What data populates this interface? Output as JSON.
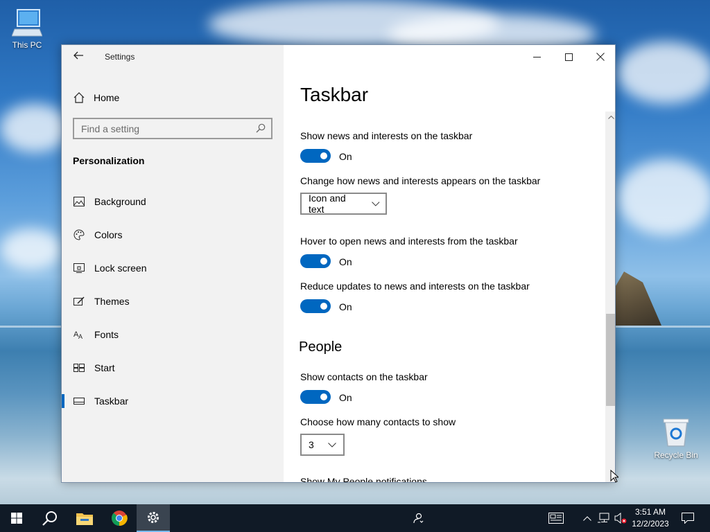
{
  "desktop": {
    "icons": [
      {
        "label": "This PC",
        "icon": "computer-icon"
      },
      {
        "label": "Recycle Bin",
        "icon": "recycle-bin-icon"
      }
    ]
  },
  "window": {
    "title": "Settings",
    "controls": {
      "minimize": "minimize-icon",
      "maximize": "maximize-icon",
      "close": "close-icon"
    }
  },
  "sidebar": {
    "home_label": "Home",
    "search_placeholder": "Find a setting",
    "section_label": "Personalization",
    "items": [
      {
        "label": "Background",
        "icon": "picture-icon"
      },
      {
        "label": "Colors",
        "icon": "palette-icon"
      },
      {
        "label": "Lock screen",
        "icon": "lock-screen-icon"
      },
      {
        "label": "Themes",
        "icon": "brush-icon"
      },
      {
        "label": "Fonts",
        "icon": "font-icon"
      },
      {
        "label": "Start",
        "icon": "start-icon"
      },
      {
        "label": "Taskbar",
        "icon": "taskbar-icon",
        "active": true
      }
    ]
  },
  "main": {
    "title": "Taskbar",
    "settings": [
      {
        "label": "Show news and interests on the taskbar",
        "toggle": "On"
      },
      {
        "label": "Change how news and interests appears on the taskbar",
        "dropdown": "Icon and text"
      },
      {
        "label": "Hover to open news and interests from the taskbar",
        "toggle": "On"
      },
      {
        "label": "Reduce updates to news and interests on the taskbar",
        "toggle": "On"
      }
    ],
    "people_heading": "People",
    "people_settings": [
      {
        "label": "Show contacts on the taskbar",
        "toggle": "On"
      },
      {
        "label": "Choose how many contacts to show",
        "dropdown": "3"
      },
      {
        "label": "Show My People notifications"
      }
    ]
  },
  "taskbar": {
    "buttons": [
      "start-icon",
      "search-icon",
      "file-explorer-icon",
      "chrome-icon",
      "settings-gear-icon"
    ],
    "tray": [
      "people-icon",
      "news-icon",
      "chevron-up-icon",
      "network-icon",
      "volume-muted-icon"
    ],
    "time": "3:51 AM",
    "date": "12/2/2023",
    "notification_icon": "action-center-icon"
  },
  "colors": {
    "accent": "#0067c0",
    "taskbar": "#101a26",
    "sidebar": "#f2f2f2"
  }
}
